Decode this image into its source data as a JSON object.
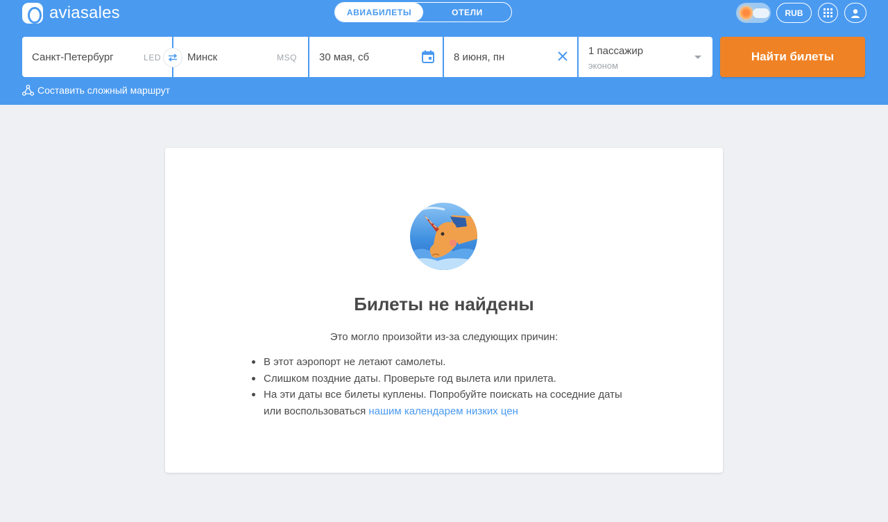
{
  "header": {
    "logo_text": "aviasales",
    "tabs": [
      {
        "label": "АВИАБИЛЕТЫ",
        "active": true
      },
      {
        "label": "ОТЕЛИ",
        "active": false
      }
    ],
    "currency": "RUB",
    "icons": {
      "theme_toggle": "day-night-toggle-icon",
      "apps": "apps-grid-icon",
      "account": "user-icon"
    }
  },
  "search": {
    "origin": {
      "city": "Санкт-Петербург",
      "iata": "LED"
    },
    "destination": {
      "city": "Минск",
      "iata": "MSQ"
    },
    "depart_date": "30 мая, сб",
    "return_date": "8 июня, пн",
    "passengers": "1 пассажир",
    "cabin_class": "эконом",
    "search_button": "Найти билеты",
    "complex_route": "Составить сложный маршрут"
  },
  "result": {
    "title": "Билеты не найдены",
    "subtitle": "Это могло произойти из-за следующих причин:",
    "reasons": [
      "В этот аэропорт не летают самолеты.",
      "Слишком поздние даты. Проверьте год вылета или прилета.",
      "На эти даты все билеты куплены. Попробуйте поискать на соседние даты или воспользоваться"
    ],
    "calendar_link": "нашим календарем низких цен",
    "mascot_icon": "unicorn-mascot"
  },
  "colors": {
    "header_bg": "#4a9af0",
    "accent": "#4a9af0",
    "button_orange": "#f08226",
    "page_bg": "#eef0f3"
  }
}
